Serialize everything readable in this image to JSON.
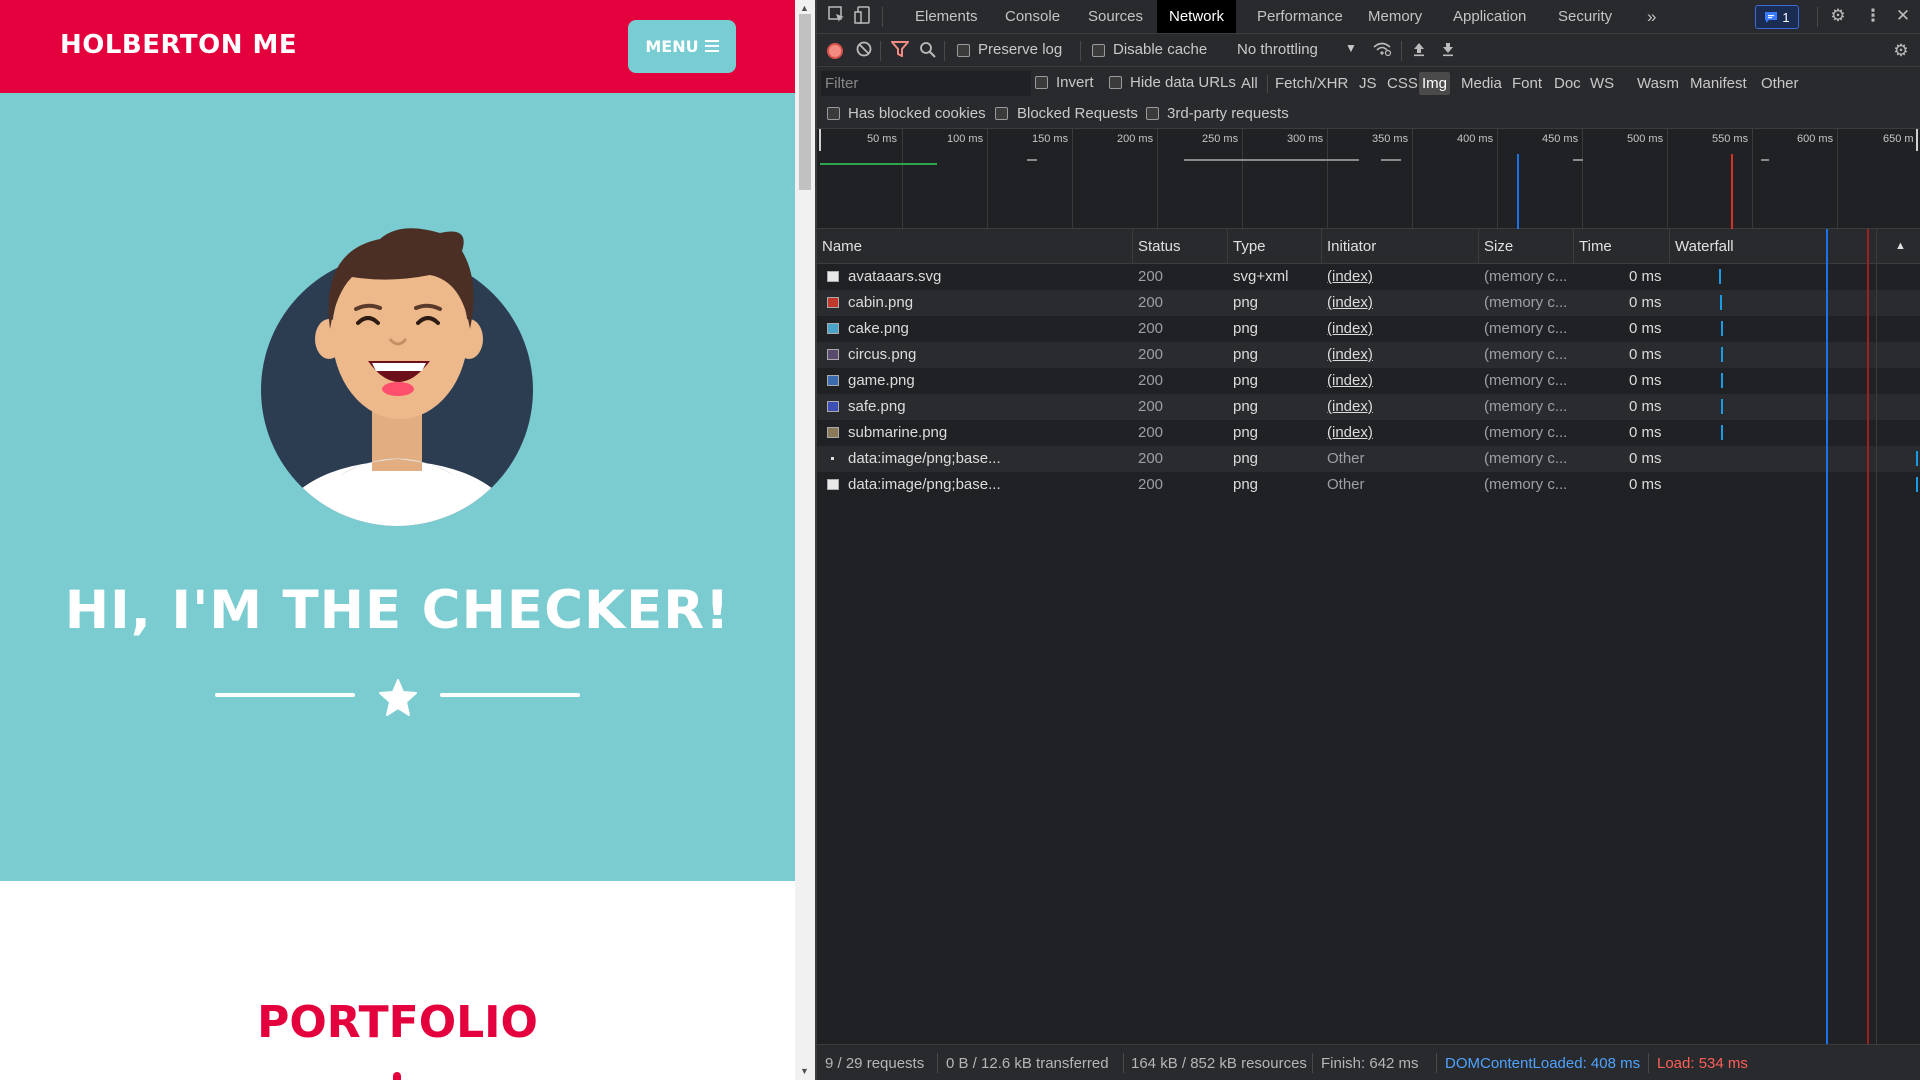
{
  "site": {
    "brand": "HOLBERTON ME",
    "menu_label": "MENU",
    "hero_title": "HI, I'M THE CHECKER!",
    "portfolio_title": "PORTFOLIO",
    "colors": {
      "header": "#e4003c",
      "hero": "#7accd1",
      "menu_button": "#78cdd2"
    }
  },
  "devtools": {
    "tabs": [
      "Elements",
      "Console",
      "Sources",
      "Network",
      "Performance",
      "Memory",
      "Application",
      "Security"
    ],
    "active_tab": "Network",
    "issues_count": "1",
    "toolbar": {
      "preserve_log": "Preserve log",
      "disable_cache": "Disable cache",
      "throttling": "No throttling"
    },
    "filter": {
      "placeholder": "Filter",
      "invert": "Invert",
      "hide_data_urls": "Hide data URLs",
      "types": [
        "All",
        "Fetch/XHR",
        "JS",
        "CSS",
        "Img",
        "Media",
        "Font",
        "Doc",
        "WS",
        "Wasm",
        "Manifest",
        "Other"
      ],
      "active_type": "Img"
    },
    "blocked": {
      "has_blocked_cookies": "Has blocked cookies",
      "blocked_requests": "Blocked Requests",
      "third_party": "3rd-party requests"
    },
    "overview_ticks": [
      "50 ms",
      "100 ms",
      "150 ms",
      "200 ms",
      "250 ms",
      "300 ms",
      "350 ms",
      "400 ms",
      "450 ms",
      "500 ms",
      "550 ms",
      "600 ms",
      "650 m"
    ],
    "columns": [
      "Name",
      "Status",
      "Type",
      "Initiator",
      "Size",
      "Time",
      "Waterfall"
    ],
    "requests": [
      {
        "name": "avataaars.svg",
        "status": "200",
        "type": "svg+xml",
        "initiator": "(index)",
        "size": "(memory c...",
        "time": "0 ms"
      },
      {
        "name": "cabin.png",
        "status": "200",
        "type": "png",
        "initiator": "(index)",
        "size": "(memory c...",
        "time": "0 ms"
      },
      {
        "name": "cake.png",
        "status": "200",
        "type": "png",
        "initiator": "(index)",
        "size": "(memory c...",
        "time": "0 ms"
      },
      {
        "name": "circus.png",
        "status": "200",
        "type": "png",
        "initiator": "(index)",
        "size": "(memory c...",
        "time": "0 ms"
      },
      {
        "name": "game.png",
        "status": "200",
        "type": "png",
        "initiator": "(index)",
        "size": "(memory c...",
        "time": "0 ms"
      },
      {
        "name": "safe.png",
        "status": "200",
        "type": "png",
        "initiator": "(index)",
        "size": "(memory c...",
        "time": "0 ms"
      },
      {
        "name": "submarine.png",
        "status": "200",
        "type": "png",
        "initiator": "(index)",
        "size": "(memory c...",
        "time": "0 ms"
      },
      {
        "name": "data:image/png;base...",
        "status": "200",
        "type": "png",
        "initiator": "Other",
        "size": "(memory c...",
        "time": "0 ms"
      },
      {
        "name": "data:image/png;base...",
        "status": "200",
        "type": "png",
        "initiator": "Other",
        "size": "(memory c...",
        "time": "0 ms"
      }
    ],
    "status_bar": {
      "requests": "9 / 29 requests",
      "transferred": "0 B / 12.6 kB transferred",
      "resources": "164 kB / 852 kB resources",
      "finish": "Finish: 642 ms",
      "dom_content_loaded": "DOMContentLoaded: 408 ms",
      "load": "Load: 534 ms"
    }
  }
}
